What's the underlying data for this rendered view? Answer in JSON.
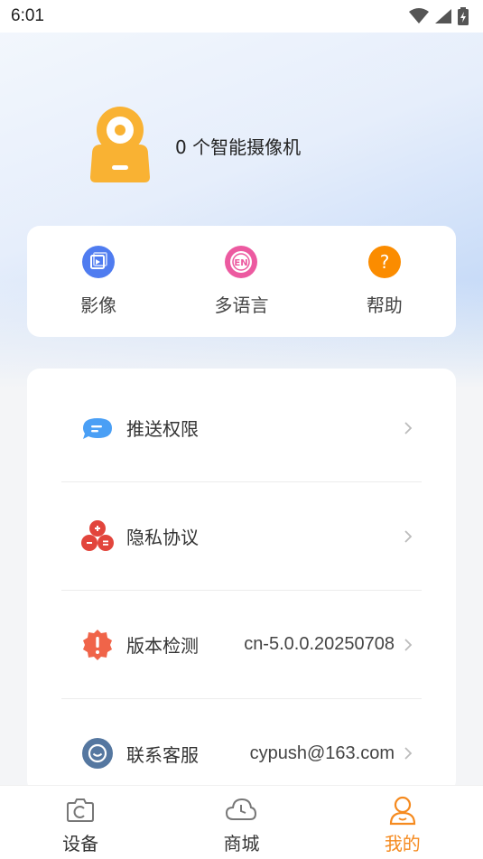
{
  "status_bar": {
    "time": "6:01"
  },
  "profile": {
    "camera_count_text": "0 个智能摄像机"
  },
  "quick_actions": [
    {
      "label": "影像",
      "icon": "video-icon",
      "color": "#4f7cf0"
    },
    {
      "label": "多语言",
      "icon": "language-en-icon",
      "color": "#ec5aa0"
    },
    {
      "label": "帮助",
      "icon": "help-icon",
      "color": "#fb8c00"
    }
  ],
  "settings": [
    {
      "label": "推送权限",
      "value": "",
      "icon": "push-message-icon"
    },
    {
      "label": "隐私协议",
      "value": "",
      "icon": "privacy-icon"
    },
    {
      "label": "版本检测",
      "value": "cn-5.0.0.20250708",
      "icon": "version-alert-icon"
    },
    {
      "label": "联系客服",
      "value": "cypush@163.com",
      "icon": "customer-service-icon"
    }
  ],
  "tabs": [
    {
      "label": "设备",
      "icon": "device-camera-icon",
      "active": false
    },
    {
      "label": "商城",
      "icon": "mall-cloud-icon",
      "active": false
    },
    {
      "label": "我的",
      "icon": "profile-icon",
      "active": true
    }
  ],
  "colors": {
    "accent": "#f58a1f",
    "card_bg": "#ffffff",
    "page_bg": "#f4f5f7"
  }
}
